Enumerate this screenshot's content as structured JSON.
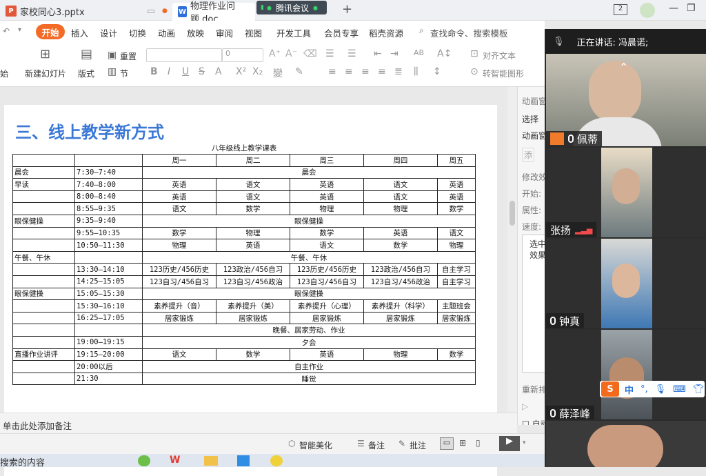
{
  "titlebar": {
    "tab1": "家校同心3.pptx",
    "tab2": "物理作业问题.doc",
    "meeting_badge": "腾讯会议",
    "plus": "+",
    "page_indicator": "2"
  },
  "menu": {
    "start": "开始",
    "items": [
      "插入",
      "设计",
      "切换",
      "动画",
      "放映",
      "审阅",
      "视图",
      "开发工具",
      "会员专享",
      "稻壳资源"
    ],
    "search": "查找命令、搜索模板"
  },
  "toolbar": {
    "new_slide": "新建幻灯片",
    "layout": "版式",
    "reset": "重置",
    "section": "节",
    "font_size": "0",
    "align_text": "对齐文本",
    "smart_graphic": "转智能图形",
    "left_partial": "始"
  },
  "slide": {
    "title": "三、线上教学新方式",
    "table_caption": "八年级线上教学课表",
    "header": [
      "",
      "",
      "周一",
      "周二",
      "周三",
      "周四",
      "周五"
    ],
    "rows": [
      {
        "a": "晨会",
        "n": "",
        "t": "7:30—7:40",
        "span": "晨会"
      },
      {
        "a": "早读",
        "n": "",
        "t": "7:40—8:00",
        "cells": [
          "英语",
          "语文",
          "英语",
          "语文",
          "英语"
        ]
      },
      {
        "a": "",
        "n": "1",
        "t": "8:00—8:40",
        "cells": [
          "英语",
          "语文",
          "英语",
          "语文",
          "英语"
        ]
      },
      {
        "a": "",
        "n": "2",
        "t": "8:55—9:35",
        "cells": [
          "语文",
          "数学",
          "物理",
          "物理",
          "数学"
        ]
      },
      {
        "a": "眼保健操",
        "n": "",
        "t": "9:35—9:40",
        "span": "眼保健操"
      },
      {
        "a": "",
        "n": "3",
        "t": "9:55—10:35",
        "cells": [
          "数学",
          "物理",
          "数学",
          "英语",
          "语文"
        ]
      },
      {
        "a": "",
        "n": "4",
        "t": "10:50—11:30",
        "cells": [
          "物理",
          "英语",
          "语文",
          "数学",
          "物理"
        ]
      },
      {
        "a": "午餐、午休",
        "n": "",
        "t": "",
        "span": "午餐、午休"
      },
      {
        "a": "",
        "n": "5",
        "t": "13:30—14:10",
        "cells": [
          "123历史/456历史",
          "123政治/456自习",
          "123历史/456历史",
          "123政治/456自习",
          "自主学习"
        ]
      },
      {
        "a": "",
        "n": "6",
        "t": "14:25—15:05",
        "cells": [
          "123自习/456自习",
          "123自习/456政治",
          "123自习/456自习",
          "123自习/456政治",
          "自主学习"
        ]
      },
      {
        "a": "眼保健操",
        "n": "",
        "t": "15:05—15:30",
        "span": "眼保健操"
      },
      {
        "a": "",
        "n": "7",
        "t": "15:30—16:10",
        "cells": [
          "素养提升（音）",
          "素养提升（美）",
          "素养提升（心理）",
          "素养提升（科学）",
          "主题班会"
        ]
      },
      {
        "a": "",
        "n": "8",
        "t": "16:25—17:05",
        "cells": [
          "居家锻炼",
          "居家锻炼",
          "居家锻炼",
          "居家锻炼",
          "居家锻炼"
        ]
      },
      {
        "a": "",
        "n": "",
        "t": "",
        "span": "晚餐、居家劳动、作业"
      },
      {
        "a": "",
        "n": "",
        "t": "19:00—19:15",
        "span": "夕会"
      },
      {
        "a": "直播作业讲评",
        "n": "",
        "t": "19:15—20:00",
        "cells": [
          "语文",
          "数学",
          "英语",
          "物理",
          "数学"
        ]
      },
      {
        "a": "",
        "n": "",
        "t": "20:00以后",
        "span": "自主作业"
      },
      {
        "a": "",
        "n": "",
        "t": "21:30",
        "span": "睡觉"
      }
    ]
  },
  "rightpanel": {
    "anim_pane": "动画窗",
    "select": "选择",
    "anim2": "动画窗",
    "add": "添",
    "modify": "修改效",
    "start": "开始:",
    "property": "属性:",
    "speed": "速度:",
    "box1": "选中",
    "box2": "效果",
    "reorder": "重新排",
    "auto": "自动"
  },
  "notes": {
    "placeholder": "单击此处添加备注"
  },
  "statusbar": {
    "beautify": "智能美化",
    "notes": "备注",
    "comments": "批注"
  },
  "taskbar": {
    "search": "搜索的内容"
  },
  "meeting": {
    "speaking": "正在讲话: 冯晨诺;",
    "participants": [
      {
        "name": "佩蒂"
      },
      {
        "name": "张扬"
      },
      {
        "name": "钟真"
      },
      {
        "name": "薛泽峰"
      }
    ],
    "ime": {
      "mode": "中"
    }
  }
}
